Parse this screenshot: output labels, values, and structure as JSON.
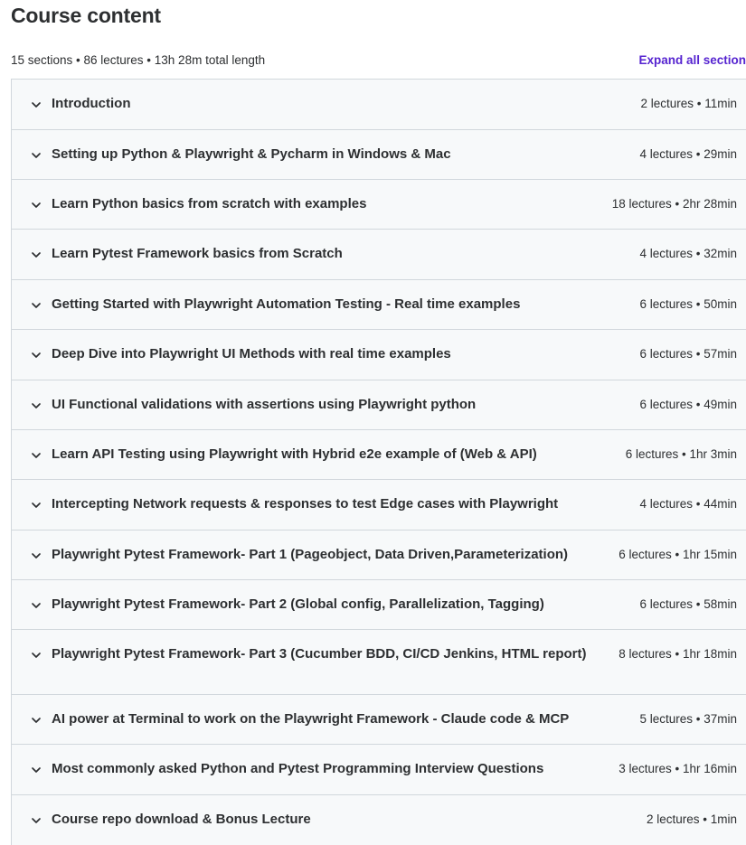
{
  "header": {
    "title": "Course content",
    "summary": "15 sections • 86 lectures • 13h 28m total length",
    "expand_all_label": "Expand all section"
  },
  "sections": [
    {
      "title": "Introduction",
      "meta": "2 lectures • 11min"
    },
    {
      "title": "Setting up Python & Playwright & Pycharm in Windows & Mac",
      "meta": "4 lectures • 29min"
    },
    {
      "title": "Learn Python basics from scratch with examples",
      "meta": "18 lectures • 2hr 28min"
    },
    {
      "title": "Learn Pytest Framework basics from Scratch",
      "meta": "4 lectures • 32min"
    },
    {
      "title": "Getting Started with Playwright Automation Testing - Real time examples",
      "meta": "6 lectures • 50min"
    },
    {
      "title": "Deep Dive into Playwright UI Methods with real time examples",
      "meta": "6 lectures • 57min"
    },
    {
      "title": "UI Functional validations with assertions using Playwright python",
      "meta": "6 lectures • 49min"
    },
    {
      "title": "Learn API Testing using Playwright with Hybrid e2e example of (Web & API)",
      "meta": "6 lectures • 1hr 3min"
    },
    {
      "title": "Intercepting Network requests & responses to test Edge cases with Playwright",
      "meta": "4 lectures • 44min"
    },
    {
      "title": "Playwright Pytest Framework- Part 1 (Pageobject, Data Driven,Parameterization)",
      "meta": "6 lectures • 1hr 15min"
    },
    {
      "title": "Playwright Pytest Framework- Part 2 (Global config, Parallelization, Tagging)",
      "meta": "6 lectures • 58min"
    },
    {
      "title": "Playwright Pytest Framework- Part 3 (Cucumber BDD, CI/CD Jenkins, HTML report)",
      "meta": "8 lectures • 1hr 18min"
    },
    {
      "title": "AI power at Terminal to work on the Playwright Framework - Claude code & MCP",
      "meta": "5 lectures • 37min"
    },
    {
      "title": "Most commonly asked Python and Pytest Programming Interview Questions",
      "meta": "3 lectures • 1hr 16min"
    },
    {
      "title": "Course repo download & Bonus Lecture",
      "meta": "2 lectures • 1min"
    }
  ],
  "icons": {
    "section_toggle": "chevron-down-icon"
  },
  "colors": {
    "accent": "#5624d0",
    "section_bg": "#f7f9fa",
    "border": "#d1d7dc",
    "text": "#2d2f31"
  }
}
